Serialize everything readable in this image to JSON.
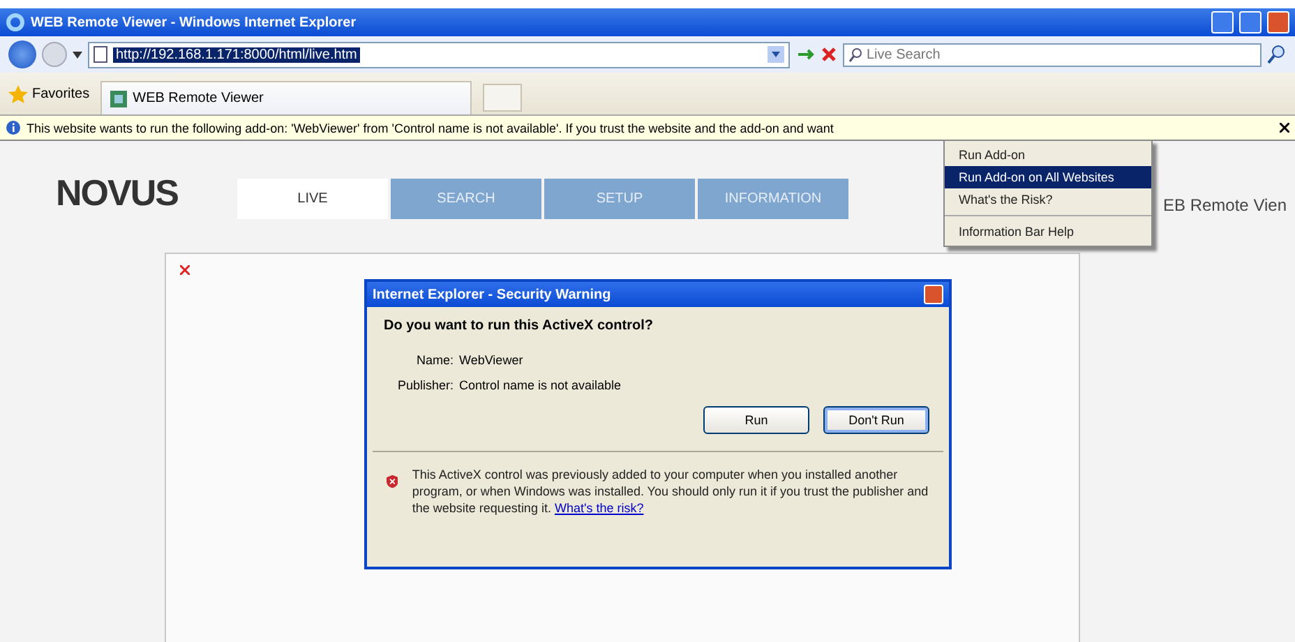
{
  "window": {
    "title": "WEB Remote Viewer - Windows Internet Explorer"
  },
  "address_bar": {
    "url": "http://192.168.1.171:8000/html/live.htm"
  },
  "search": {
    "placeholder": "Live Search"
  },
  "favorites": {
    "label": "Favorites"
  },
  "tabs": [
    {
      "label": "WEB Remote Viewer",
      "selected": true
    }
  ],
  "info_bar": {
    "text": "This website wants to run the following add-on: 'WebViewer' from 'Control name is not available'. If you trust the website and the add-on and want"
  },
  "context_menu": {
    "items": [
      {
        "label": "Run Add-on",
        "selected": false,
        "separator_before": false
      },
      {
        "label": "Run Add-on on All Websites",
        "selected": true,
        "separator_before": false
      },
      {
        "label": "What's the Risk?",
        "selected": false,
        "separator_before": false
      },
      {
        "label": "Information Bar Help",
        "selected": false,
        "separator_before": true
      }
    ]
  },
  "page": {
    "logo": "NOVUS",
    "header_text": "EB Remote Vien",
    "nav_tabs": [
      {
        "label": "LIVE",
        "selected": true
      },
      {
        "label": "SEARCH",
        "selected": false
      },
      {
        "label": "SETUP",
        "selected": false
      },
      {
        "label": "INFORMATION",
        "selected": false
      }
    ]
  },
  "dialog": {
    "title": "Internet Explorer - Security Warning",
    "question": "Do you want to run this ActiveX control?",
    "fields": [
      {
        "label": "Name:",
        "value": "WebViewer"
      },
      {
        "label": "Publisher:",
        "value": "Control name is not available"
      }
    ],
    "buttons": [
      {
        "label": "Run",
        "default": false
      },
      {
        "label": "Don't Run",
        "default": true
      }
    ],
    "warning": "This ActiveX control was previously added to your computer when you installed another program, or when Windows was installed. You should only run it if you trust the publisher and the website requesting it.",
    "link": "What's the risk?"
  }
}
